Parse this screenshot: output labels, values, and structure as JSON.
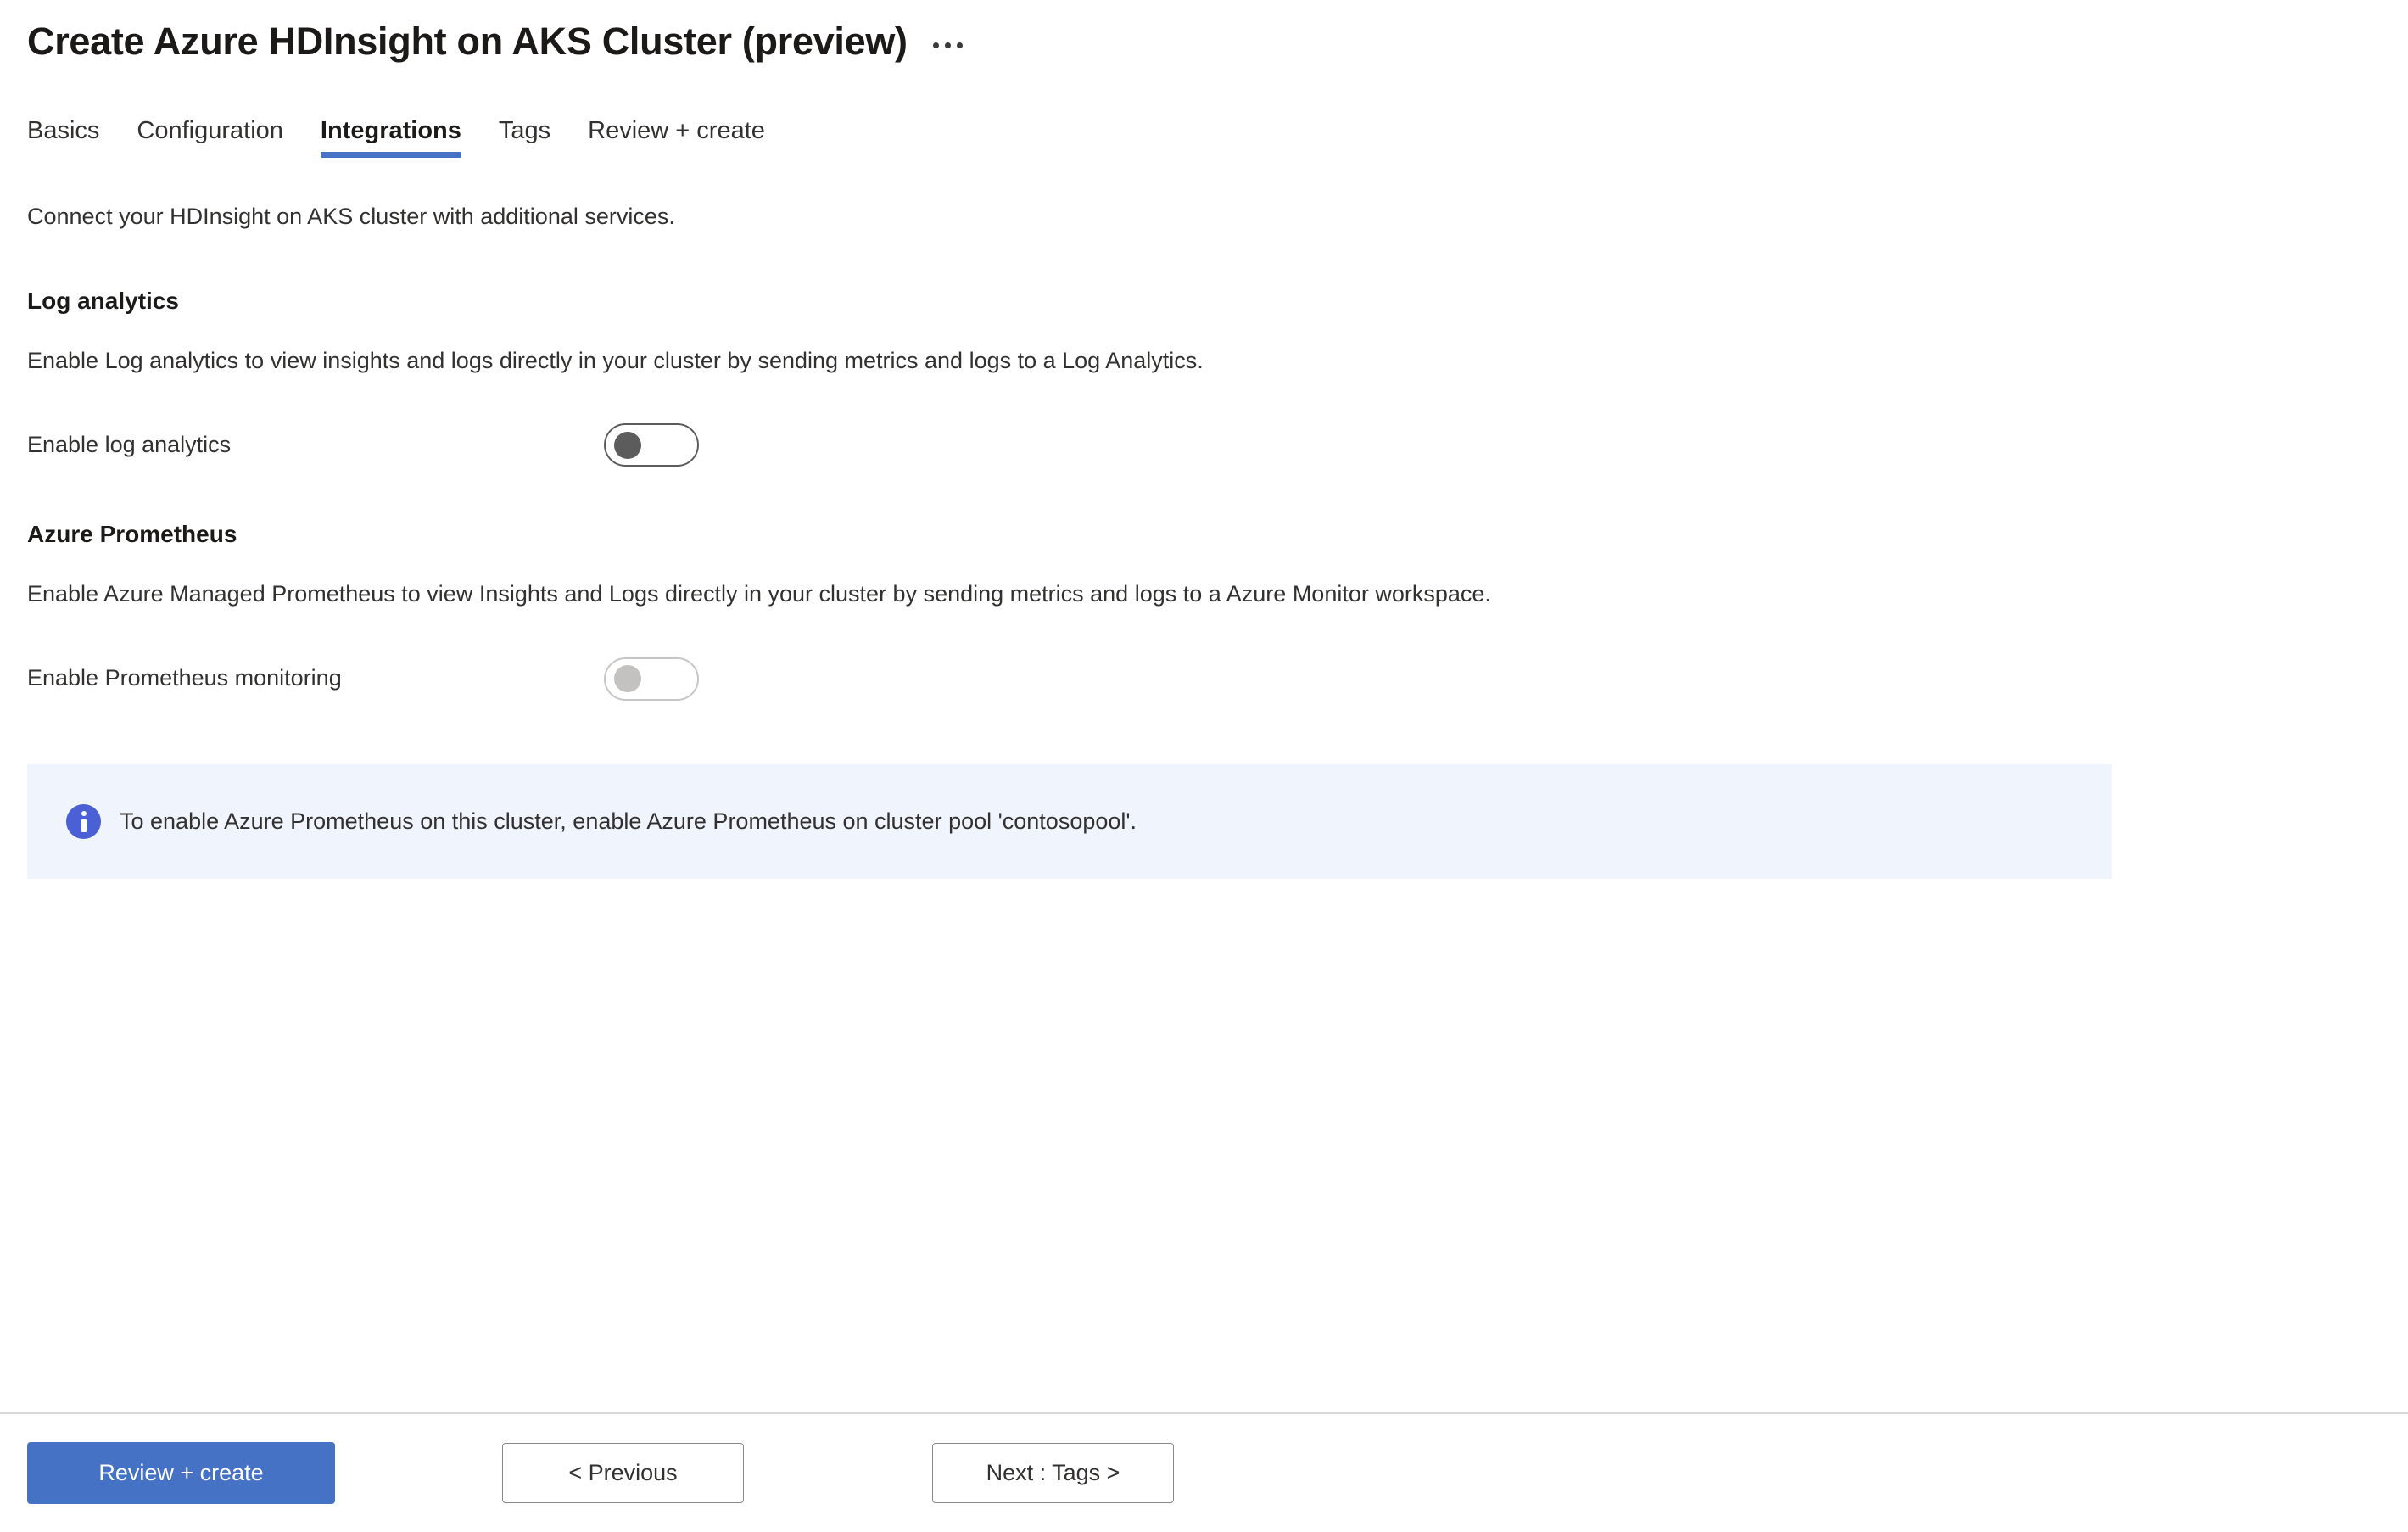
{
  "header": {
    "title": "Create Azure HDInsight on AKS Cluster (preview)",
    "more_menu_label": "..."
  },
  "tabs": [
    {
      "label": "Basics",
      "active": false
    },
    {
      "label": "Configuration",
      "active": false
    },
    {
      "label": "Integrations",
      "active": true
    },
    {
      "label": "Tags",
      "active": false
    },
    {
      "label": "Review + create",
      "active": false
    }
  ],
  "main": {
    "intro": "Connect your HDInsight on AKS cluster with additional services.",
    "sections": [
      {
        "heading": "Log analytics",
        "description": "Enable Log analytics to view insights and logs directly in your cluster by sending metrics and logs to a Log Analytics.",
        "field_label": "Enable log analytics",
        "toggle_state": "off",
        "toggle_disabled": false
      },
      {
        "heading": "Azure Prometheus",
        "description": "Enable Azure Managed Prometheus to view Insights and Logs directly in your cluster by sending metrics and logs to a Azure Monitor workspace.",
        "field_label": "Enable Prometheus monitoring",
        "toggle_state": "off",
        "toggle_disabled": true
      }
    ],
    "info_banner": {
      "icon": "info-icon",
      "text": "To enable Azure Prometheus on this cluster, enable Azure Prometheus on cluster pool 'contosopool'."
    }
  },
  "footer": {
    "review_create_label": "Review + create",
    "previous_label": "< Previous",
    "next_label": "Next : Tags >"
  },
  "colors": {
    "accent_blue": "#4572c4",
    "info_banner_bg": "#f0f4fd",
    "info_icon_blue": "#4a60d4",
    "toggle_enabled_gray": "#5c5c5c",
    "toggle_disabled_gray": "#c4c2c0",
    "text_primary": "#323130"
  }
}
